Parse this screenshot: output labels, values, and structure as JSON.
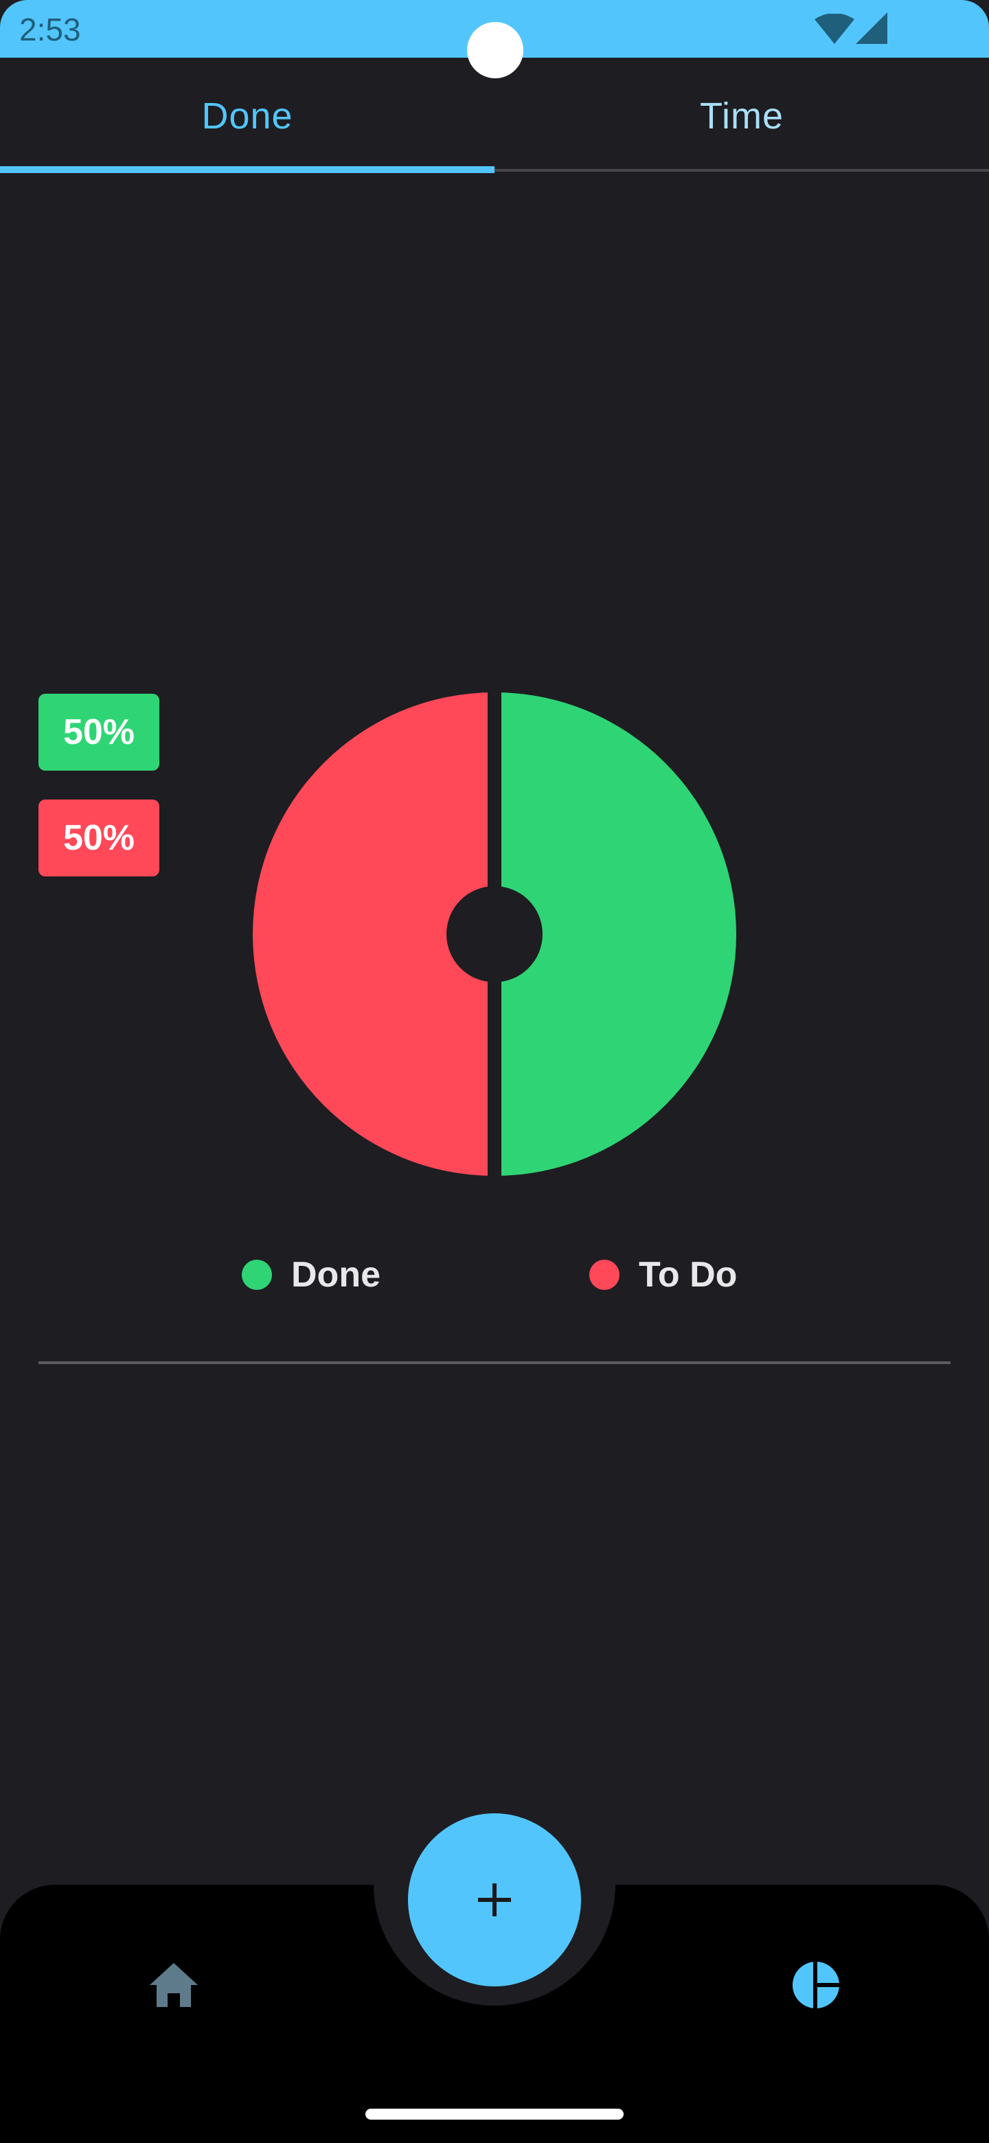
{
  "status_bar": {
    "time": "2:53",
    "color": "#52c6fc",
    "icons": [
      "wifi-icon",
      "signal-icon"
    ]
  },
  "tabs": [
    {
      "label": "Done",
      "selected": true
    },
    {
      "label": "Time",
      "selected": false
    }
  ],
  "colors": {
    "accent": "#52c6fc",
    "done": "#2fd574",
    "todo": "#ff4858",
    "background": "#1e1d22",
    "nav_background": "#000000"
  },
  "chart_data": {
    "type": "pie",
    "donut": true,
    "categories": [
      "Done",
      "To Do"
    ],
    "values": [
      50,
      50
    ],
    "colors": [
      "#2fd574",
      "#ff4858"
    ],
    "percent_labels": [
      "50%",
      "50%"
    ],
    "legend": "bottom"
  },
  "legend": [
    {
      "label": "Done",
      "color": "#2fd574"
    },
    {
      "label": "To Do",
      "color": "#ff4858"
    }
  ],
  "bottom_nav": {
    "items": [
      {
        "icon": "home-icon",
        "selected": false
      },
      {
        "icon": "add-icon",
        "selected": false
      },
      {
        "icon": "pie-chart-icon",
        "selected": true
      }
    ]
  }
}
